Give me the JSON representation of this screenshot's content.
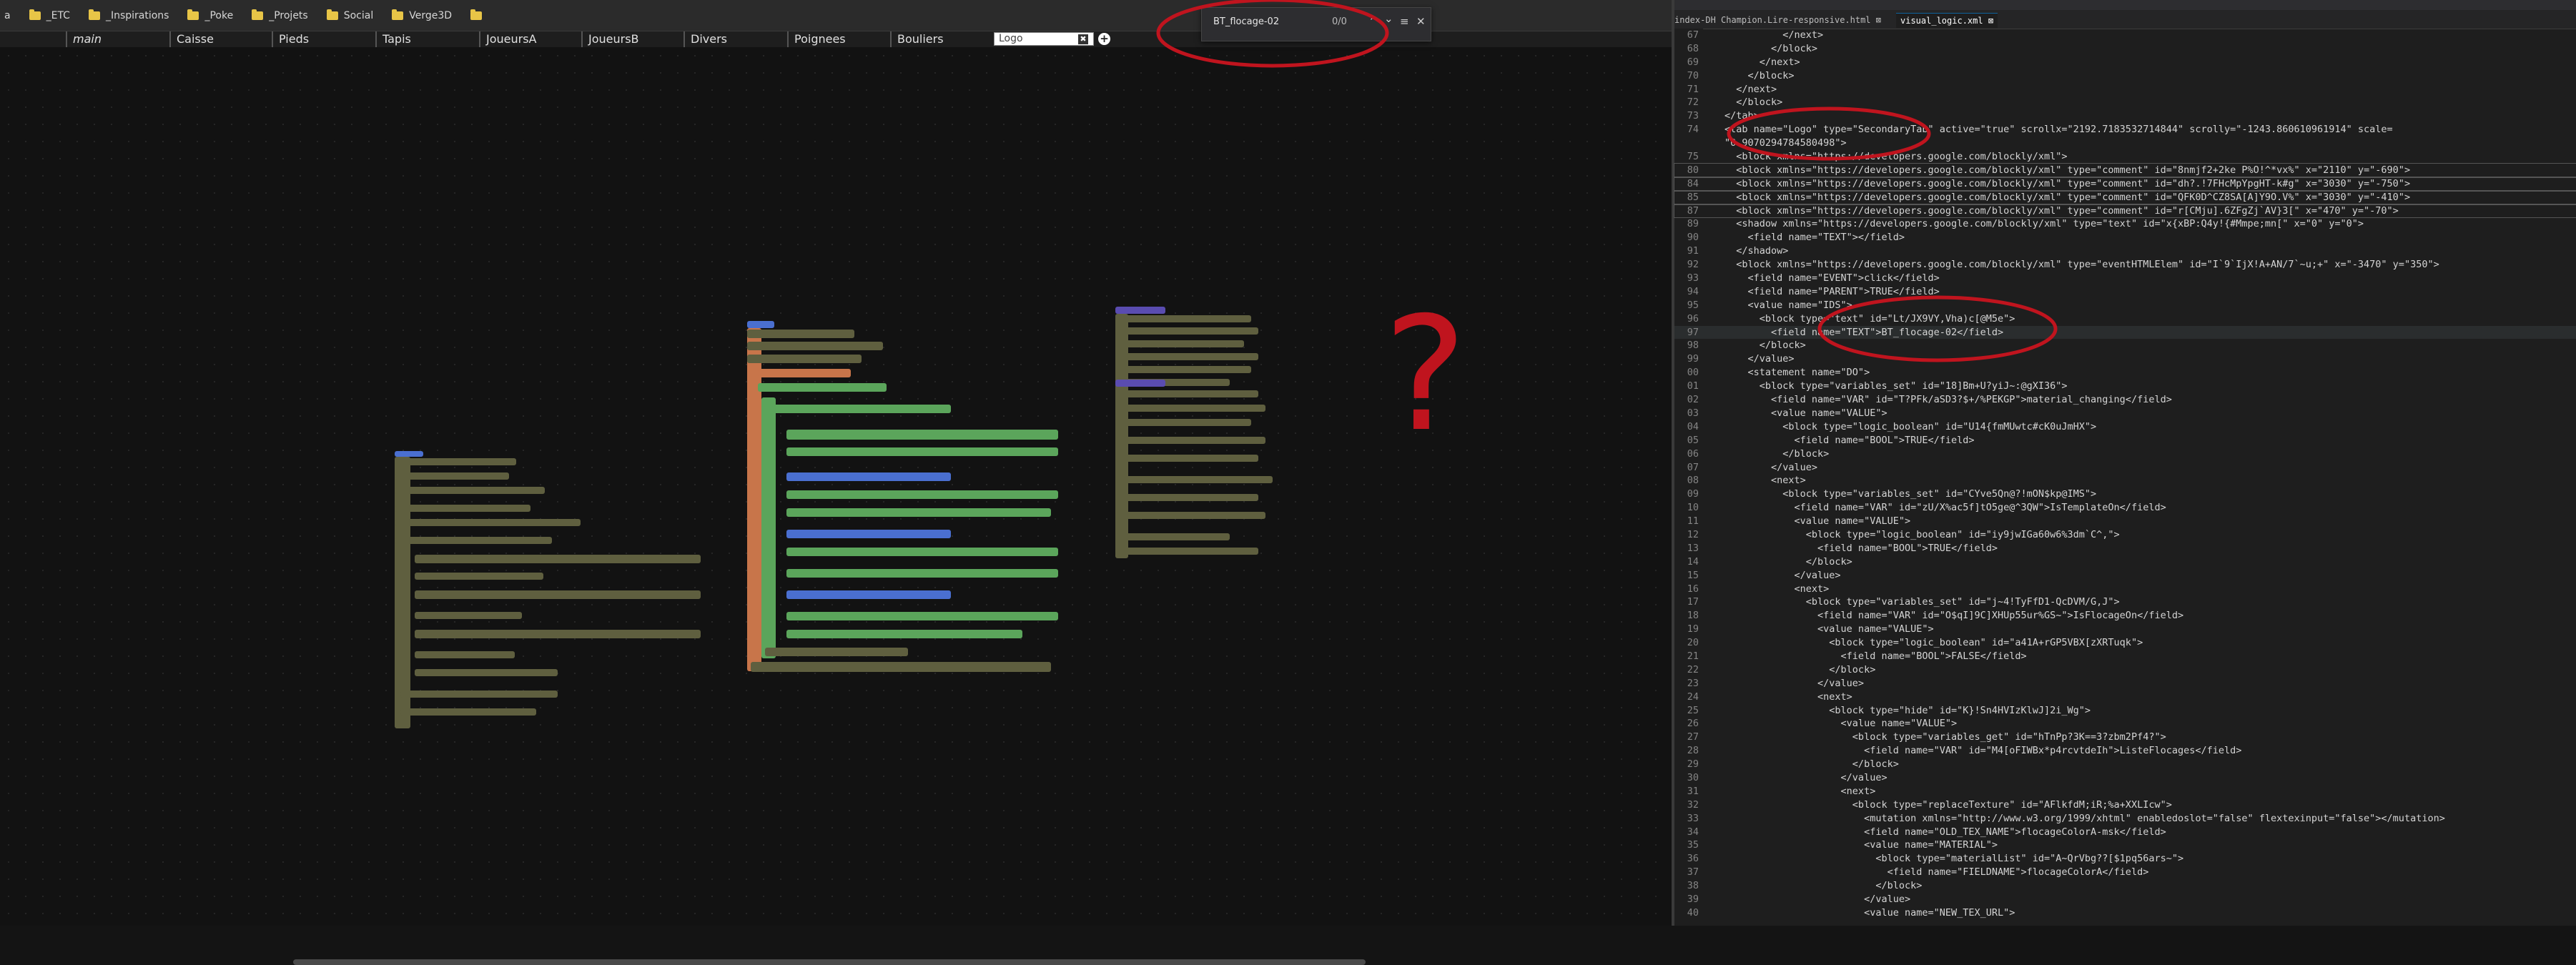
{
  "bookmarks": [
    {
      "label": "a"
    },
    {
      "label": "_ETC"
    },
    {
      "label": "_Inspirations"
    },
    {
      "label": "_Poke"
    },
    {
      "label": "_Projets"
    },
    {
      "label": "Social"
    },
    {
      "label": "Verge3D"
    },
    {
      "label": ""
    }
  ],
  "tabs": [
    "main",
    "Caisse",
    "Pieds",
    "Tapis",
    "JoueursA",
    "JoueursB",
    "Divers",
    "Poignees",
    "Bouliers"
  ],
  "tab_input": {
    "value": "Logo",
    "close": "✖",
    "add": "+"
  },
  "find": {
    "text": "BT_flocage-02",
    "count": "0/0",
    "up": "⌃",
    "down": "⌄",
    "menu": "≡",
    "close": "✕"
  },
  "editor": {
    "tabs": [
      {
        "label": "index-DH Champion.Lire-responsive.html",
        "close": "⊠"
      },
      {
        "label": "visual_logic.xml",
        "close": "⊠"
      }
    ],
    "lines": [
      {
        "n": "67",
        "t": "          </next>"
      },
      {
        "n": "68",
        "t": "        </block>"
      },
      {
        "n": "69",
        "t": "      </next>"
      },
      {
        "n": "70",
        "t": "    </block>"
      },
      {
        "n": "71",
        "t": "  </next>"
      },
      {
        "n": "72",
        "t": "  </block>"
      },
      {
        "n": "73",
        "t": "</tab>"
      },
      {
        "n": "74",
        "t": "<tab name=\"Logo\" type=\"SecondaryTab\" active=\"true\" scrollx=\"2192.7183532714844\" scrolly=\"-1243.860610961914\" scale="
      },
      {
        "n": "",
        "t": "\"0.9070294784580498\">"
      },
      {
        "n": "75",
        "t": "  <block xmlns=\"https://developers.google.com/blockly/xml\">"
      },
      {
        "n": "80",
        "t": "  <block xmlns=\"https://developers.google.com/blockly/xml\" type=\"comment\" id=\"8nmjf2+2ke P%O!^*vx%\" x=\"2110\" y=\"-690\">"
      },
      {
        "n": "84",
        "t": "  <block xmlns=\"https://developers.google.com/blockly/xml\" type=\"comment\" id=\"dh?.!7FHcMpYpgHT-k#g\" x=\"3030\" y=\"-750\">"
      },
      {
        "n": "85",
        "t": "  <block xmlns=\"https://developers.google.com/blockly/xml\" type=\"comment\" id=\"QFK0D^CZ8SA[A]Y9O.V%\" x=\"3030\" y=\"-410\">"
      },
      {
        "n": "87",
        "t": "  <block xmlns=\"https://developers.google.com/blockly/xml\" type=\"comment\" id=\"r[CMju].6ZFgZj`AV}3[\" x=\"470\" y=\"-70\">"
      },
      {
        "n": "89",
        "t": "  <shadow xmlns=\"https://developers.google.com/blockly/xml\" type=\"text\" id=\"x{xBP:Q4y!{#Mmpe;mn[\" x=\"0\" y=\"0\">"
      },
      {
        "n": "90",
        "t": "    <field name=\"TEXT\"></field>"
      },
      {
        "n": "91",
        "t": "  </shadow>"
      },
      {
        "n": "92",
        "t": "  <block xmlns=\"https://developers.google.com/blockly/xml\" type=\"eventHTMLElem\" id=\"I`9`IjX!A+AN/7`~u;+\" x=\"-3470\" y=\"350\">"
      },
      {
        "n": "93",
        "t": "    <field name=\"EVENT\">click</field>"
      },
      {
        "n": "94",
        "t": "    <field name=\"PARENT\">TRUE</field>"
      },
      {
        "n": "95",
        "t": "    <value name=\"IDS\">"
      },
      {
        "n": "96",
        "t": "      <block type=\"text\" id=\"Lt/JX9VY,Vha)c[@M5e\">"
      },
      {
        "n": "97",
        "t": "        <field name=\"TEXT\">BT_flocage-02</field>"
      },
      {
        "n": "98",
        "t": "      </block>"
      },
      {
        "n": "99",
        "t": "    </value>"
      },
      {
        "n": "00",
        "t": "    <statement name=\"DO\">"
      },
      {
        "n": "01",
        "t": "      <block type=\"variables_set\" id=\"18]Bm+U?yiJ~:@gXI36\">"
      },
      {
        "n": "02",
        "t": "        <field name=\"VAR\" id=\"T?PFk/aSD3?$+/%PEKGP\">material_changing</field>"
      },
      {
        "n": "03",
        "t": "        <value name=\"VALUE\">"
      },
      {
        "n": "04",
        "t": "          <block type=\"logic_boolean\" id=\"U14{fmMUwtc#cK0uJmHX\">"
      },
      {
        "n": "05",
        "t": "            <field name=\"BOOL\">TRUE</field>"
      },
      {
        "n": "06",
        "t": "          </block>"
      },
      {
        "n": "07",
        "t": "        </value>"
      },
      {
        "n": "08",
        "t": "        <next>"
      },
      {
        "n": "09",
        "t": "          <block type=\"variables_set\" id=\"CYve5Qn@?!mON$kp@IMS\">"
      },
      {
        "n": "10",
        "t": "            <field name=\"VAR\" id=\"zU/X%ac5f]tO5ge@^3QW\">IsTemplateOn</field>"
      },
      {
        "n": "11",
        "t": "            <value name=\"VALUE\">"
      },
      {
        "n": "12",
        "t": "              <block type=\"logic_boolean\" id=\"iy9jwIGa60w6%3dm`C^,\">"
      },
      {
        "n": "13",
        "t": "                <field name=\"BOOL\">TRUE</field>"
      },
      {
        "n": "14",
        "t": "              </block>"
      },
      {
        "n": "15",
        "t": "            </value>"
      },
      {
        "n": "16",
        "t": "            <next>"
      },
      {
        "n": "17",
        "t": "              <block type=\"variables_set\" id=\"j~4!TyFfD1-QcDVM/G,J\">"
      },
      {
        "n": "18",
        "t": "                <field name=\"VAR\" id=\"O$qI]9C]XHUp55ur%GS~\">IsFlocageOn</field>"
      },
      {
        "n": "19",
        "t": "                <value name=\"VALUE\">"
      },
      {
        "n": "20",
        "t": "                  <block type=\"logic_boolean\" id=\"a41A+rGP5VBX[zXRTuqk\">"
      },
      {
        "n": "21",
        "t": "                    <field name=\"BOOL\">FALSE</field>"
      },
      {
        "n": "22",
        "t": "                  </block>"
      },
      {
        "n": "23",
        "t": "                </value>"
      },
      {
        "n": "24",
        "t": "                <next>"
      },
      {
        "n": "25",
        "t": "                  <block type=\"hide\" id=\"K}!Sn4HVIzKlwJ]2i_Wg\">"
      },
      {
        "n": "26",
        "t": "                    <value name=\"VALUE\">"
      },
      {
        "n": "27",
        "t": "                      <block type=\"variables_get\" id=\"hTnPp?3K==3?zbm2Pf4?\">"
      },
      {
        "n": "28",
        "t": "                        <field name=\"VAR\" id=\"M4[oFIWBx*p4rcvtdeIh\">ListeFlocages</field>"
      },
      {
        "n": "29",
        "t": "                      </block>"
      },
      {
        "n": "30",
        "t": "                    </value>"
      },
      {
        "n": "31",
        "t": "                    <next>"
      },
      {
        "n": "32",
        "t": "                      <block type=\"replaceTexture\" id=\"AFlkfdM;iR;%a+XXLIcw\">"
      },
      {
        "n": "33",
        "t": "                        <mutation xmlns=\"http://www.w3.org/1999/xhtml\" enabledoslot=\"false\" flextexinput=\"false\"></mutation>"
      },
      {
        "n": "34",
        "t": "                        <field name=\"OLD_TEX_NAME\">flocageColorA-msk</field>"
      },
      {
        "n": "35",
        "t": "                        <value name=\"MATERIAL\">"
      },
      {
        "n": "36",
        "t": "                          <block type=\"materialList\" id=\"A~QrVbg??[$1pq56ars~\">"
      },
      {
        "n": "37",
        "t": "                            <field name=\"FIELDNAME\">flocageColorA</field>"
      },
      {
        "n": "38",
        "t": "                          </block>"
      },
      {
        "n": "39",
        "t": "                        </value>"
      },
      {
        "n": "40",
        "t": "                        <value name=\"NEW_TEX_URL\">"
      }
    ]
  },
  "annotation": {
    "symbol": "?"
  },
  "colors": {
    "annotation": "#c0141e",
    "block_olive": "#5f5f3f",
    "block_green": "#5ba55b",
    "block_orange": "#c8754a",
    "block_blue": "#4a6fd0",
    "block_purple": "#5a4cb0"
  }
}
